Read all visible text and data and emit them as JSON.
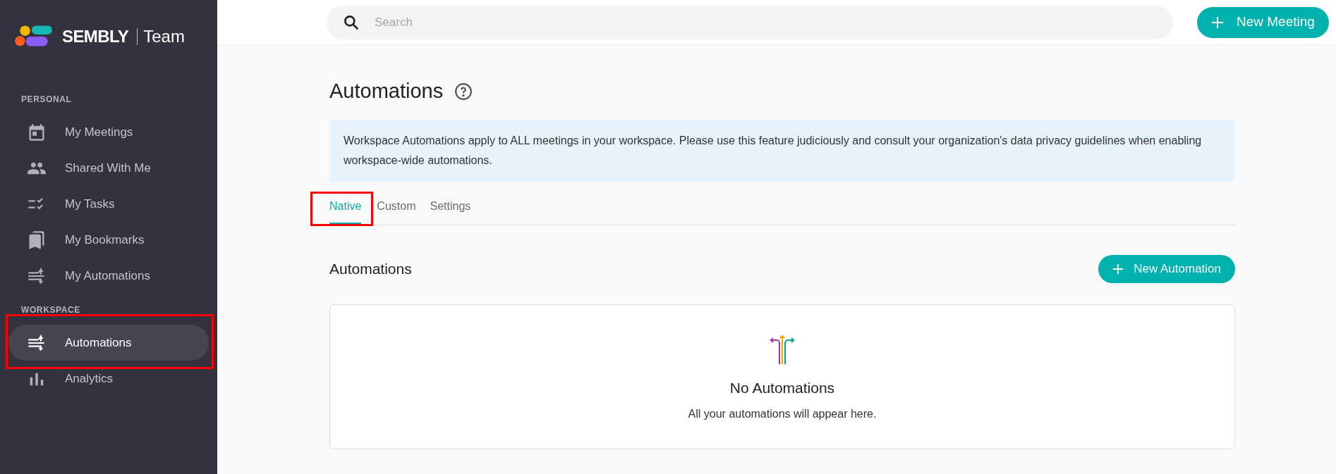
{
  "brand": {
    "name": "SEMBLY",
    "edition": "Team"
  },
  "sidebar": {
    "sections": [
      {
        "heading": "PERSONAL",
        "items": [
          {
            "label": "My Meetings",
            "kind": "calendar",
            "selected": false
          },
          {
            "label": "Shared With Me",
            "kind": "people",
            "selected": false
          },
          {
            "label": "My Tasks",
            "kind": "tasks",
            "selected": false
          },
          {
            "label": "My Bookmarks",
            "kind": "bookmarks",
            "selected": false
          },
          {
            "label": "My Automations",
            "kind": "automations",
            "selected": false
          }
        ]
      },
      {
        "heading": "WORKSPACE",
        "items": [
          {
            "label": "Automations",
            "kind": "automations",
            "selected": true,
            "highlighted": true
          },
          {
            "label": "Analytics",
            "kind": "analytics",
            "selected": false
          }
        ]
      }
    ]
  },
  "search": {
    "placeholder": "Search"
  },
  "new_meeting_button": "New Meeting",
  "page": {
    "title": "Automations",
    "notice": "Workspace Automations apply to ALL meetings in your workspace. Please use this feature judiciously and consult your organization's data privacy guidelines when enabling workspace-wide automations.",
    "tabs": [
      {
        "label": "Native",
        "selected": true,
        "highlighted": true
      },
      {
        "label": "Custom",
        "selected": false
      },
      {
        "label": "Settings",
        "selected": false
      }
    ],
    "section_title": "Automations",
    "new_automation_button": "New Automation",
    "empty_state": {
      "title": "No Automations",
      "message": "All your automations will appear here."
    }
  }
}
